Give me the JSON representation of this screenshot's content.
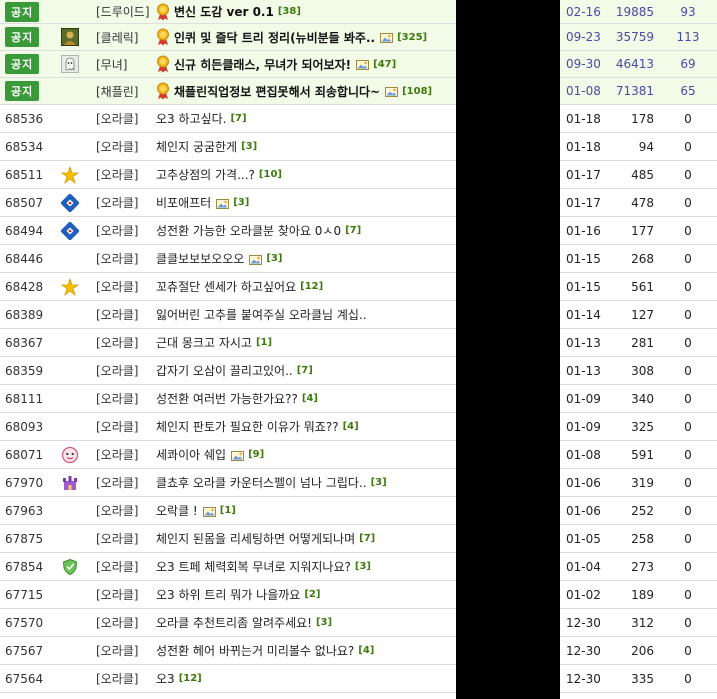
{
  "notice_badge": "공지",
  "notices": [
    {
      "category": "[드루이드]",
      "title": "변신 도감 ver 0.1",
      "count": "[38]",
      "has_image": false,
      "icon": "",
      "date": "02-16",
      "views": "19885",
      "rec": "93"
    },
    {
      "category": "[클레릭]",
      "title": "인퀴 및 즐닥 트리 정리(뉴비분들 봐주..",
      "count": "[325]",
      "has_image": true,
      "icon": "avatar-portrait-icon",
      "date": "09-23",
      "views": "35759",
      "rec": "113"
    },
    {
      "category": "[무녀]",
      "title": "신규 히든클래스, 무녀가 되어보자!",
      "count": "[47]",
      "has_image": true,
      "icon": "avatar-ghost-icon",
      "date": "09-30",
      "views": "46413",
      "rec": "69"
    },
    {
      "category": "[채플린]",
      "title": "채플린직업정보 편집못해서 죄송합니다~",
      "count": "[108]",
      "has_image": true,
      "icon": "",
      "date": "01-08",
      "views": "71381",
      "rec": "65"
    }
  ],
  "posts": [
    {
      "num": "68536",
      "icon": "",
      "category": "[오라클]",
      "title": "오3 하고싶다.",
      "count": "[7]",
      "has_image": false,
      "date": "01-18",
      "views": "178",
      "rec": "0"
    },
    {
      "num": "68534",
      "icon": "",
      "category": "[오라클]",
      "title": "체인지 궁굼한게",
      "count": "[3]",
      "has_image": false,
      "date": "01-18",
      "views": "94",
      "rec": "0"
    },
    {
      "num": "68511",
      "icon": "star-icon",
      "category": "[오라클]",
      "title": "고추상점의 가격...?",
      "count": "[10]",
      "has_image": false,
      "date": "01-17",
      "views": "485",
      "rec": "0"
    },
    {
      "num": "68507",
      "icon": "domino-icon",
      "category": "[오라클]",
      "title": "비포애프터",
      "count": "[3]",
      "has_image": true,
      "date": "01-17",
      "views": "478",
      "rec": "0"
    },
    {
      "num": "68494",
      "icon": "domino-icon",
      "category": "[오라클]",
      "title": "성전환 가능한 오라클분 찾아요 0ㅅ0",
      "count": "[7]",
      "has_image": false,
      "date": "01-16",
      "views": "177",
      "rec": "0"
    },
    {
      "num": "68446",
      "icon": "",
      "category": "[오라클]",
      "title": "클클보보보오오오",
      "count": "[3]",
      "has_image": true,
      "date": "01-15",
      "views": "268",
      "rec": "0"
    },
    {
      "num": "68428",
      "icon": "star-icon",
      "category": "[오라클]",
      "title": "꼬츄절단 센세가 하고싶어요",
      "count": "[12]",
      "has_image": false,
      "date": "01-15",
      "views": "561",
      "rec": "0"
    },
    {
      "num": "68389",
      "icon": "",
      "category": "[오라클]",
      "title": "잃어버린 고추를 붙여주실 오라클님 계십..",
      "count": "",
      "has_image": false,
      "date": "01-14",
      "views": "127",
      "rec": "0"
    },
    {
      "num": "68367",
      "icon": "",
      "category": "[오라클]",
      "title": "근대 몽크고 자시고",
      "count": "[1]",
      "has_image": false,
      "date": "01-13",
      "views": "281",
      "rec": "0"
    },
    {
      "num": "68359",
      "icon": "",
      "category": "[오라클]",
      "title": "갑자기 오삼이 끌리고있어..",
      "count": "[7]",
      "has_image": false,
      "date": "01-13",
      "views": "308",
      "rec": "0"
    },
    {
      "num": "68111",
      "icon": "",
      "category": "[오라클]",
      "title": "성전환 여러번 가능한가요??",
      "count": "[4]",
      "has_image": false,
      "date": "01-09",
      "views": "340",
      "rec": "0"
    },
    {
      "num": "68093",
      "icon": "",
      "category": "[오라클]",
      "title": "체인지 판토가 필요한 이유가 뭐죠??",
      "count": "[4]",
      "has_image": false,
      "date": "01-09",
      "views": "325",
      "rec": "0"
    },
    {
      "num": "68071",
      "icon": "face-icon",
      "category": "[오라클]",
      "title": "세콰이아 쉐입",
      "count": "[9]",
      "has_image": true,
      "date": "01-08",
      "views": "591",
      "rec": "0"
    },
    {
      "num": "67970",
      "icon": "castle-icon",
      "category": "[오라클]",
      "title": "클쵸후 오라클 카운터스펠이 넘나 그립다..",
      "count": "[3]",
      "has_image": false,
      "date": "01-06",
      "views": "319",
      "rec": "0"
    },
    {
      "num": "67963",
      "icon": "",
      "category": "[오라클]",
      "title": "오락클 !",
      "count": "[1]",
      "has_image": true,
      "date": "01-06",
      "views": "252",
      "rec": "0"
    },
    {
      "num": "67875",
      "icon": "",
      "category": "[오라클]",
      "title": "체인지 된몸을 리세팅하면 어떻게되나며",
      "count": "[7]",
      "has_image": false,
      "date": "01-05",
      "views": "258",
      "rec": "0"
    },
    {
      "num": "67854",
      "icon": "shield-icon",
      "category": "[오라클]",
      "title": "오3 트페 체력회복 무녀로 지워지나요?",
      "count": "[3]",
      "has_image": false,
      "date": "01-04",
      "views": "273",
      "rec": "0"
    },
    {
      "num": "67715",
      "icon": "",
      "category": "[오라클]",
      "title": "오3 하위 트리 뭐가 나을까요",
      "count": "[2]",
      "has_image": false,
      "date": "01-02",
      "views": "189",
      "rec": "0"
    },
    {
      "num": "67570",
      "icon": "",
      "category": "[오라클]",
      "title": "오라클 추천트리좀 알려주세요!",
      "count": "[3]",
      "has_image": false,
      "date": "12-30",
      "views": "312",
      "rec": "0"
    },
    {
      "num": "67567",
      "icon": "",
      "category": "[오라클]",
      "title": "성전환 헤어 바뀌는거 미리볼수 없나요?",
      "count": "[4]",
      "has_image": false,
      "date": "12-30",
      "views": "206",
      "rec": "0"
    },
    {
      "num": "67564",
      "icon": "",
      "category": "[오라클]",
      "title": "오3",
      "count": "[12]",
      "has_image": false,
      "date": "12-30",
      "views": "335",
      "rec": "0"
    }
  ]
}
